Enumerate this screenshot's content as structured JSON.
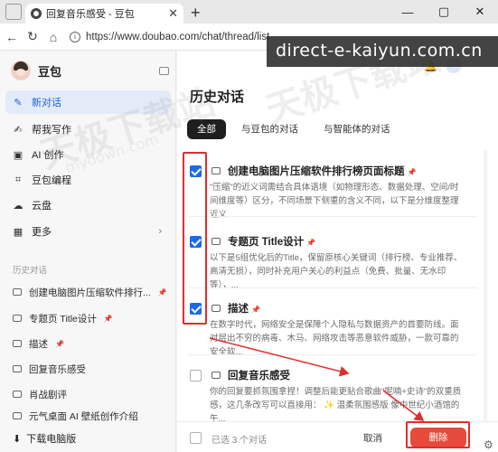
{
  "browser": {
    "tab_title": "回复音乐感受 - 豆包",
    "url": "https://www.doubao.com/chat/thread/list"
  },
  "overlay": {
    "watermark_banner": "direct-e-kaiyun.com.cn",
    "watermark_text": "天极下载站",
    "watermark_url": "mydown.com"
  },
  "sidebar": {
    "app_name": "豆包",
    "nav": [
      {
        "label": "新对话",
        "icon": "new-chat-icon",
        "active": true
      },
      {
        "label": "帮我写作",
        "icon": "pen-icon"
      },
      {
        "label": "AI 创作",
        "icon": "image-icon"
      },
      {
        "label": "豆包编程",
        "icon": "code-icon"
      },
      {
        "label": "云盘",
        "icon": "cloud-icon"
      },
      {
        "label": "更多",
        "icon": "grid-icon"
      }
    ],
    "history_heading": "历史对话",
    "history": [
      "创建电脑图片压缩软件排行...",
      "专题页 Title设计",
      "描述",
      "回复音乐感受",
      "肖战剧评",
      "元气桌面 AI 壁纸创作介绍"
    ],
    "download_label": "下载电脑版"
  },
  "main": {
    "title": "历史对话",
    "tabs": [
      "全部",
      "与豆包的对话",
      "与智能体的对话"
    ],
    "conversations": [
      {
        "title": "创建电脑图片压缩软件排行榜页面标题",
        "checked": true,
        "snippet": "\"压缩\"的近义词需结合具体语境（如物理形态、数据处理、空间/时间维度等）区分，不同场景下侧重的含义不同，以下是分维度整理 近义..."
      },
      {
        "title": "专题页 Title设计",
        "checked": true,
        "snippet": "以下是5组优化后的Title，保留原核心关键词（排行榜、专业推荐、高清无损），同时补充用户关心的利益点（免费、批量、无水印等），..."
      },
      {
        "title": "描述",
        "checked": true,
        "snippet": "在数字时代，网络安全是保障个人隐私与数据资产的首要防线。面对层出不穷的病毒、木马、网络攻击等恶意软件威胁，一款可靠的安全软..."
      },
      {
        "title": "回复音乐感受",
        "checked": false,
        "snippet": "你的回复要抓氛围拿捏！调整后能更贴合歌曲\"呢喃+史诗\"的双重质感，这几条改写可以直接用： ✨ 温柔氛围感版 像中世纪小酒馆的午..."
      }
    ],
    "footer": {
      "selected_text": "已选 3 个对话",
      "cancel_label": "取消",
      "delete_label": "删除"
    }
  },
  "colors": {
    "accent": "#1a6be6",
    "delete": "#e74a3b",
    "annotation": "#e02d2d"
  }
}
